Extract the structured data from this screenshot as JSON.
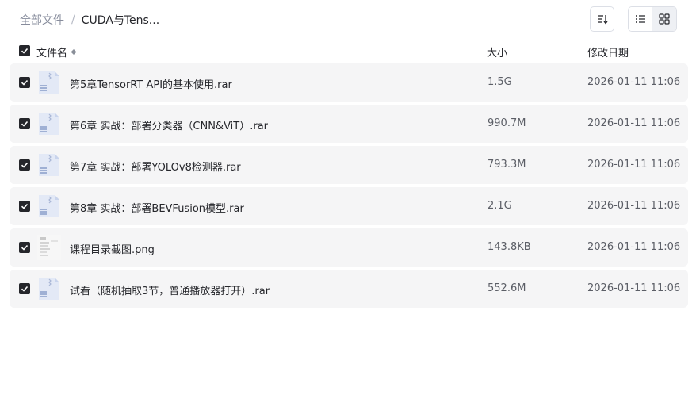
{
  "breadcrumb": {
    "root": "全部文件",
    "separator": "/",
    "current": "CUDA与Tens..."
  },
  "toolbar": {
    "sort_icon": "sort-icon",
    "list_view_icon": "list-view-icon",
    "grid_view_icon": "grid-view-icon",
    "active_view": "list"
  },
  "columns": {
    "name": "文件名",
    "size": "大小",
    "modified": "修改日期"
  },
  "files": [
    {
      "name": "第5章TensorRT API的基本使用.rar",
      "size": "1.5G",
      "date": "2026-01-11 11:06",
      "type": "archive",
      "selected": true
    },
    {
      "name": "第6章 实战：部署分类器（CNN&ViT）.rar",
      "size": "990.7M",
      "date": "2026-01-11 11:06",
      "type": "archive",
      "selected": true
    },
    {
      "name": "第7章 实战：部署YOLOv8检测器.rar",
      "size": "793.3M",
      "date": "2026-01-11 11:06",
      "type": "archive",
      "selected": true
    },
    {
      "name": "第8章 实战：部署BEVFusion模型.rar",
      "size": "2.1G",
      "date": "2026-01-11 11:06",
      "type": "archive",
      "selected": true
    },
    {
      "name": "课程目录截图.png",
      "size": "143.8KB",
      "date": "2026-01-11 11:06",
      "type": "image",
      "selected": true
    },
    {
      "name": "试看（随机抽取3节，普通播放器打开）.rar",
      "size": "552.6M",
      "date": "2026-01-11 11:06",
      "type": "archive",
      "selected": true
    }
  ],
  "colors": {
    "row_bg": "#f5f5f6",
    "checkbox": "#25262b",
    "archive_icon": "#dfe6f5",
    "archive_accent": "#a9b7d6"
  }
}
